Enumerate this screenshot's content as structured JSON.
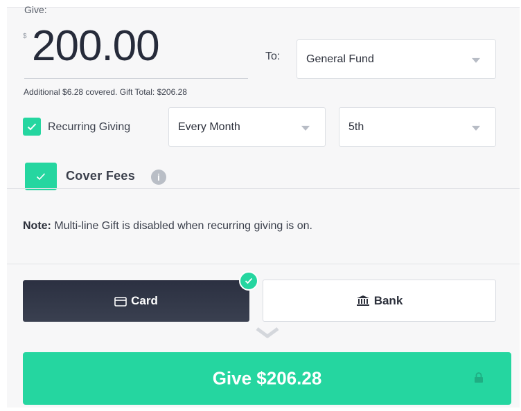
{
  "give": {
    "label": "Give:",
    "currency_symbol": "$",
    "amount": "200.00",
    "additional_note": "Additional $6.28 covered. Gift Total: $206.28"
  },
  "to": {
    "label": "To:",
    "fund": "General Fund"
  },
  "recurring": {
    "checked": true,
    "label": "Recurring Giving",
    "frequency": "Every Month",
    "day": "5th"
  },
  "cover_fees": {
    "checked": true,
    "label": "Cover Fees",
    "info_icon": "info-icon"
  },
  "note": {
    "prefix": "Note:",
    "text": " Multi-line Gift is disabled when recurring giving is on."
  },
  "payment": {
    "card_label": "Card",
    "bank_label": "Bank",
    "selected": "card",
    "card_icon": "credit-card-icon",
    "bank_icon": "bank-icon"
  },
  "submit": {
    "label": "Give $206.28",
    "lock_icon": "lock-icon"
  },
  "colors": {
    "accent": "#25d6a0",
    "dark": "#2b3041"
  }
}
